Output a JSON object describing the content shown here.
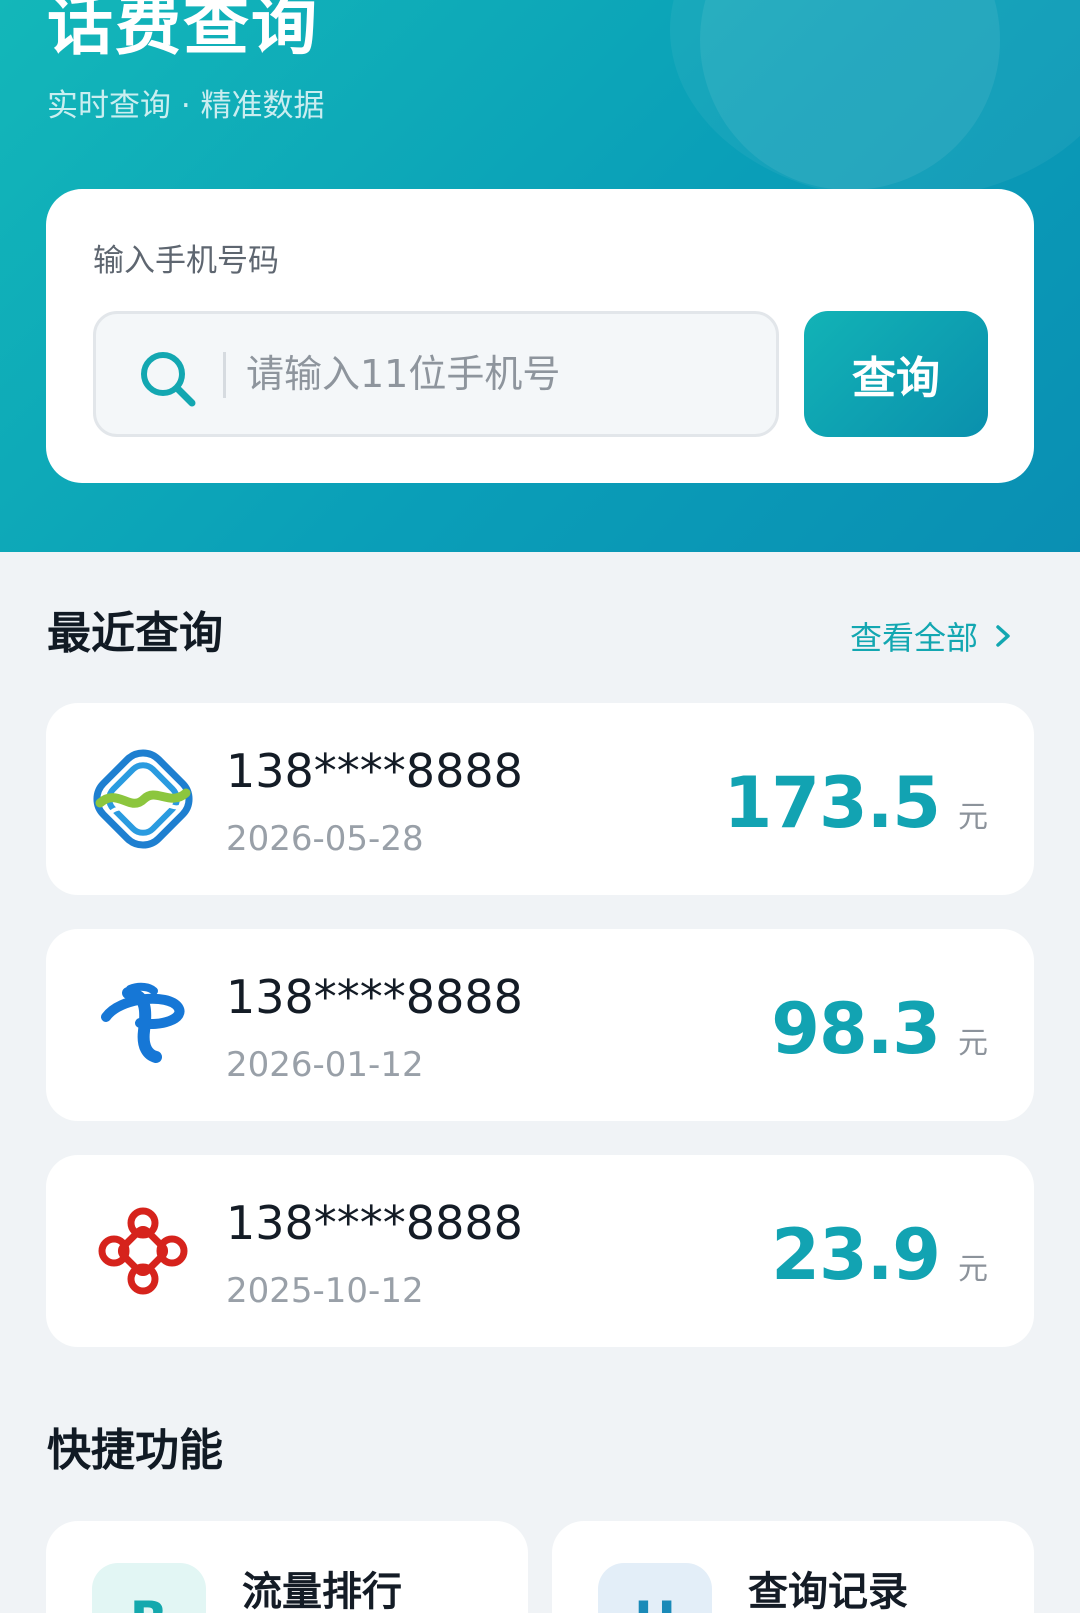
{
  "header": {
    "title": "话费查询",
    "subtitle": "实时查询 · 精准数据"
  },
  "search": {
    "label": "输入手机号码",
    "placeholder": "请输入11位手机号",
    "button_label": "查询"
  },
  "recent": {
    "title": "最近查询",
    "view_all_label": "查看全部",
    "items": [
      {
        "carrier_icon": "china-mobile-logo",
        "phone": "138****8888",
        "date": "2026-05-28",
        "amount": "173.5",
        "unit": "元"
      },
      {
        "carrier_icon": "china-telecom-logo",
        "phone": "138****8888",
        "date": "2026-01-12",
        "amount": "98.3",
        "unit": "元"
      },
      {
        "carrier_icon": "china-unicom-logo",
        "phone": "138****8888",
        "date": "2025-10-12",
        "amount": "23.9",
        "unit": "元"
      }
    ]
  },
  "quick": {
    "title": "快捷功能",
    "items": [
      {
        "icon_letter": "R",
        "label": "流量排行",
        "icon_bg": "#e2f6f4",
        "icon_color": "#14a8ad"
      },
      {
        "icon_letter": "H",
        "label": "查询记录",
        "icon_bg": "#e3eef8",
        "icon_color": "#1a8ab8"
      }
    ]
  },
  "colors": {
    "accent": "#12a3b2",
    "header_start": "#13b7b9",
    "header_end": "#0a8fb3",
    "background": "#f0f3f6"
  }
}
